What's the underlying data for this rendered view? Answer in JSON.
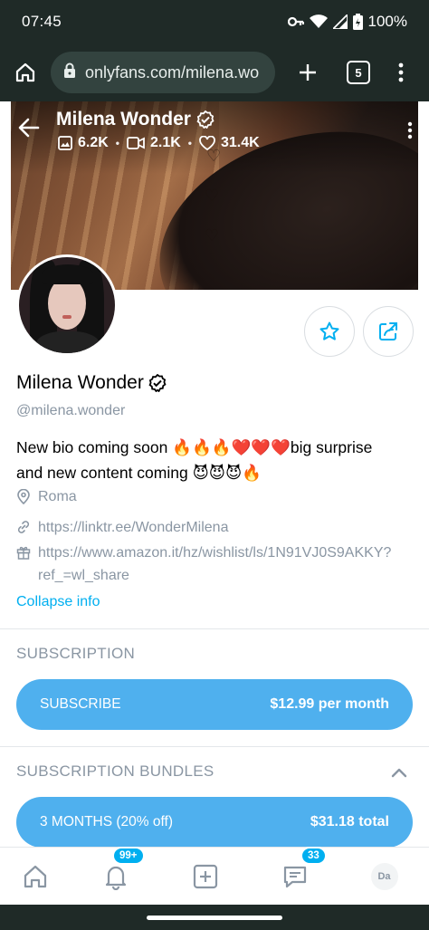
{
  "status_bar": {
    "time": "07:45",
    "battery": "100%"
  },
  "browser": {
    "url": "onlyfans.com/milena.wo",
    "tab_count": "5"
  },
  "cover": {
    "name": "Milena Wonder",
    "stats": {
      "photos": "6.2K",
      "videos": "2.1K",
      "likes": "31.4K"
    },
    "separator": "•"
  },
  "profile": {
    "name": "Milena Wonder",
    "handle": "@milena.wonder",
    "bio_line1": "New bio coming soon 🔥🔥🔥❤️❤️❤️big surprise",
    "bio_line2": "and new content coming 😈😈😈🔥",
    "location": "Roma",
    "link": "https://linktr.ee/WonderMilena",
    "wishlist_line1": "https://www.amazon.it/hz/wishlist/ls/1N91VJ0S9AKKY?",
    "wishlist_line2": "ref_=wl_share",
    "collapse_label": "Collapse info"
  },
  "subscription": {
    "title": "SUBSCRIPTION",
    "button_label": "SUBSCRIBE",
    "price": "$12.99 per month"
  },
  "bundles": {
    "title": "SUBSCRIPTION BUNDLES",
    "items": [
      {
        "label": "3 MONTHS (20% off)",
        "price": "$31.18 total"
      }
    ]
  },
  "bottom_nav": {
    "notifications_badge": "99+",
    "messages_badge": "33",
    "avatar_initials": "Da"
  },
  "colors": {
    "accent": "#00aff0",
    "button": "#4fb0ee",
    "muted": "#8a96a3",
    "chrome": "#1f2a27"
  }
}
